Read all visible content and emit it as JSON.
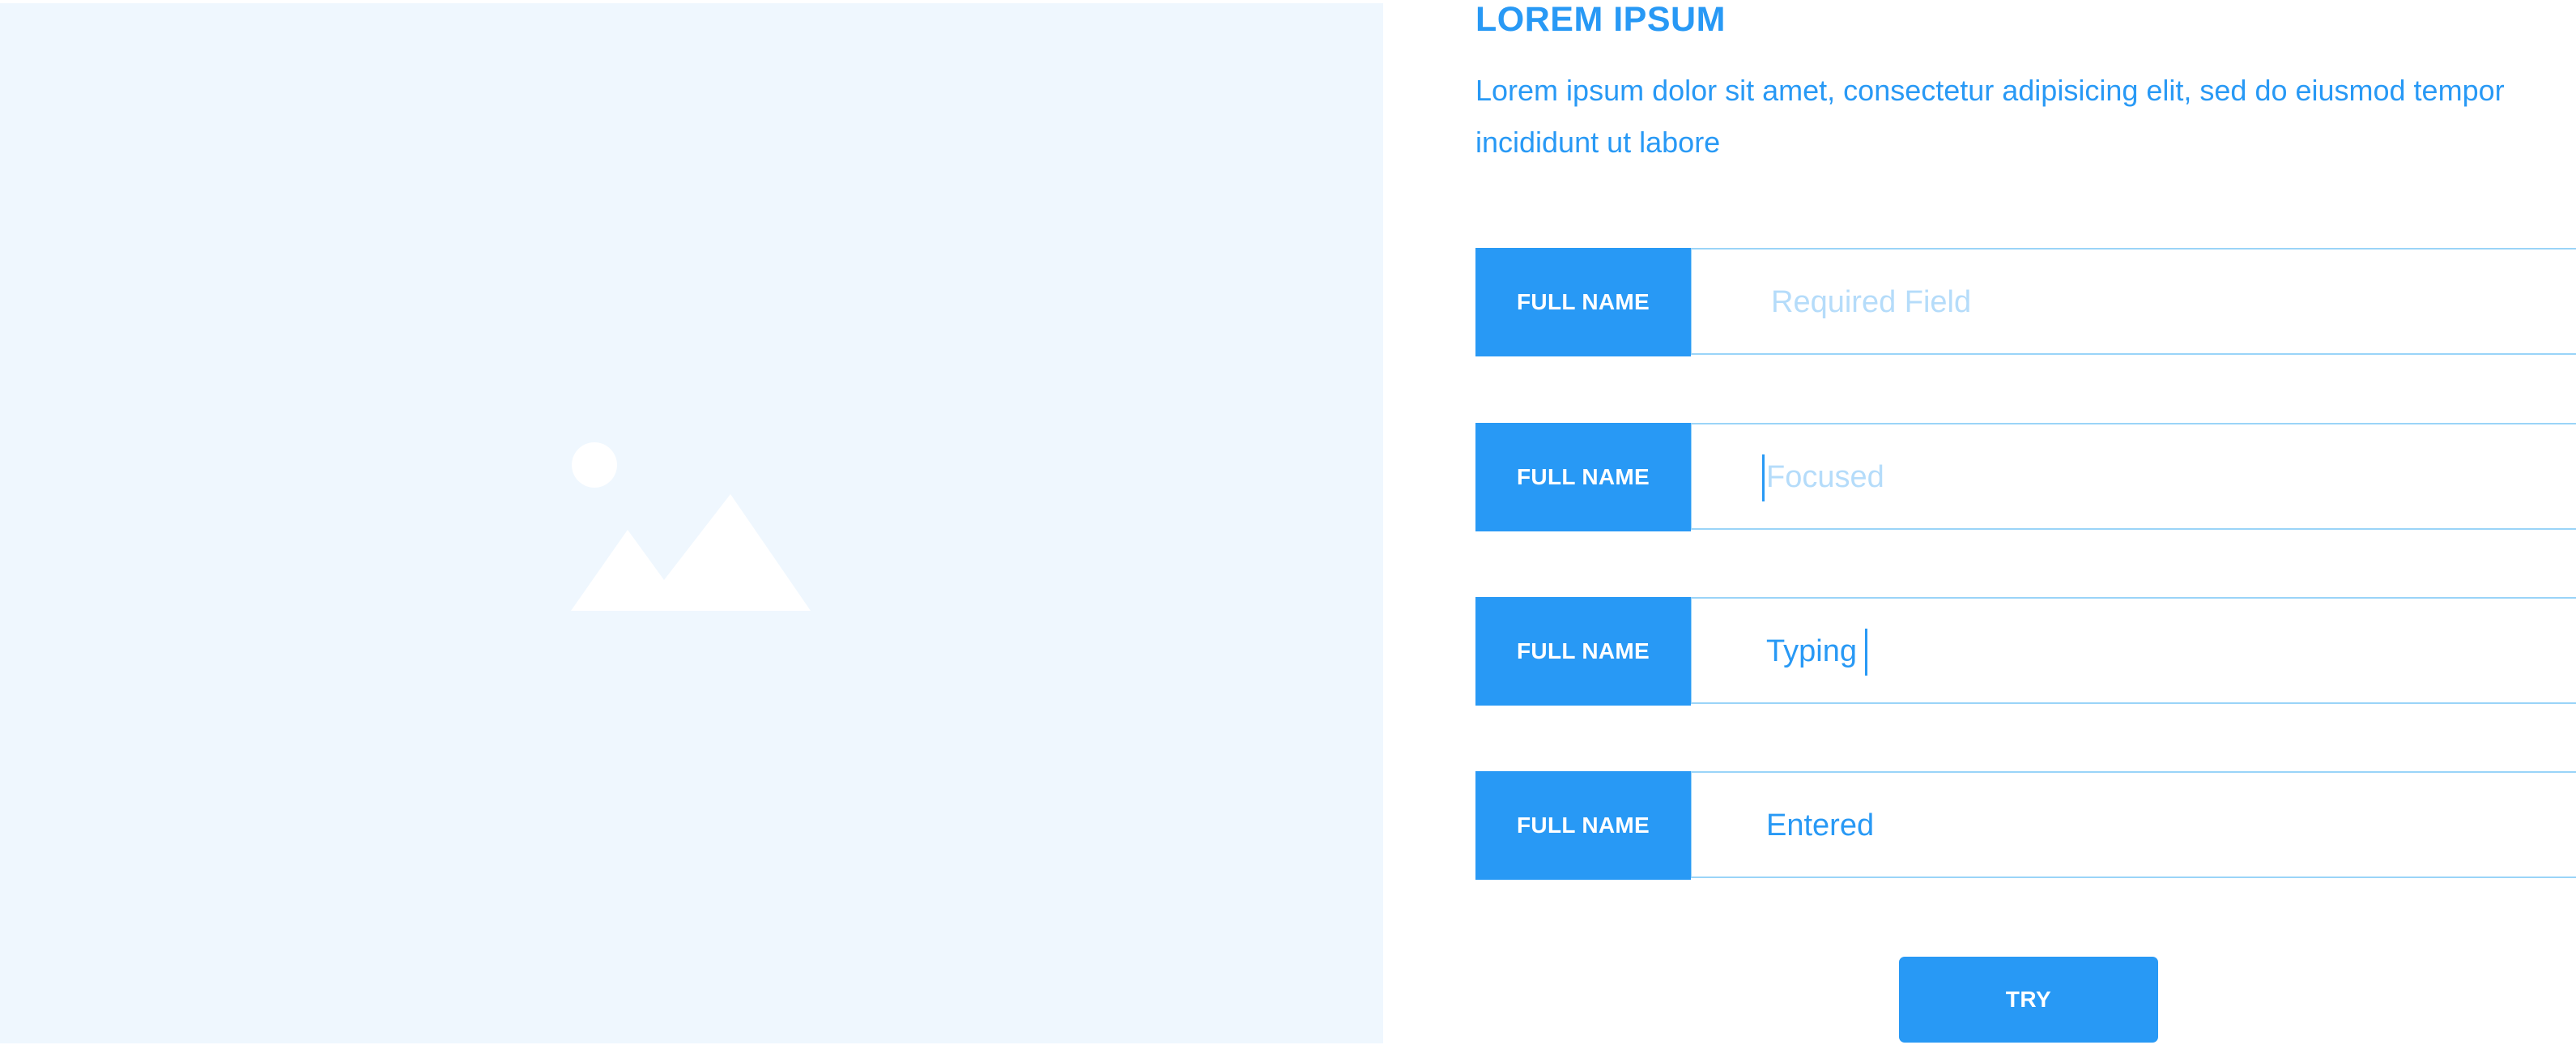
{
  "image_panel": {
    "background": "#eff7fe",
    "icon": "image-placeholder-icon"
  },
  "header": {
    "title": "LOREM IPSUM",
    "description": "Lorem ipsum dolor sit amet, consectetur adipisicing elit, sed do eiusmod tempor incididunt ut labore"
  },
  "fields": [
    {
      "label": "FULL NAME",
      "state": "required",
      "placeholder": "Required Field",
      "value": ""
    },
    {
      "label": "FULL NAME",
      "state": "focused",
      "placeholder": "Focused",
      "value": ""
    },
    {
      "label": "FULL NAME",
      "state": "typing",
      "placeholder": "",
      "value": "Typing"
    },
    {
      "label": "FULL NAME",
      "state": "entered",
      "placeholder": "",
      "value": "Entered"
    }
  ],
  "actions": {
    "try_label": "TRY"
  },
  "colors": {
    "accent": "#2899f5",
    "border": "#9ad4f8",
    "placeholder_text": "#b5dcfa",
    "panel_background": "#eff7fe"
  }
}
